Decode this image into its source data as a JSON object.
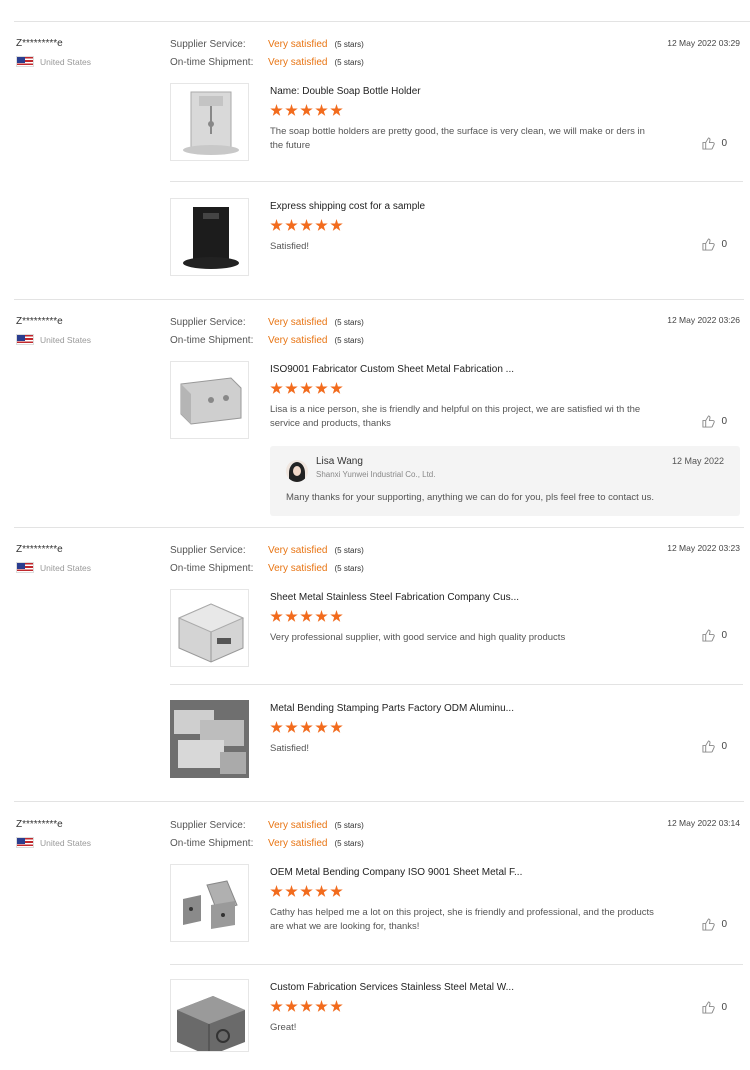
{
  "reviews": [
    {
      "user": "Z*********e",
      "country": "United States",
      "supplier_label": "Supplier Service:",
      "supplier_value": "Very satisfied",
      "supplier_stars": "(5 stars)",
      "shipment_label": "On-time Shipment:",
      "shipment_value": "Very satisfied",
      "shipment_stars": "(5 stars)",
      "date": "12 May 2022 03:29",
      "items": [
        {
          "title": "Name: Double Soap Bottle Holder",
          "rating": 5,
          "text": "The soap bottle holders are pretty good, the surface is very clean, we will make or ders in the future",
          "likes": "0",
          "image": "silver-bracket-image"
        },
        {
          "title": "Express shipping cost for a sample",
          "rating": 5,
          "text": "Satisfied!",
          "likes": "0",
          "image": "black-bracket-image"
        }
      ]
    },
    {
      "user": "Z*********e",
      "country": "United States",
      "supplier_label": "Supplier Service:",
      "supplier_value": "Very satisfied",
      "supplier_stars": "(5 stars)",
      "shipment_label": "On-time Shipment:",
      "shipment_value": "Very satisfied",
      "shipment_stars": "(5 stars)",
      "date": "12 May 2022 03:26",
      "items": [
        {
          "title": "ISO9001 Fabricator Custom Sheet Metal Fabrication ...",
          "rating": 5,
          "text": "Lisa is a nice person, she is friendly and helpful on this project, we are satisfied wi th the service and products, thanks",
          "likes": "0",
          "image": "bent-sheet-image",
          "reply": {
            "name": "Lisa Wang",
            "company": "Shanxi Yunwei Industrial Co., Ltd.",
            "date": "12 May 2022",
            "text": "Many thanks for your supporting, anything we can do for you, pls feel free to contact us."
          }
        }
      ]
    },
    {
      "user": "Z*********e",
      "country": "United States",
      "supplier_label": "Supplier Service:",
      "supplier_value": "Very satisfied",
      "supplier_stars": "(5 stars)",
      "shipment_label": "On-time Shipment:",
      "shipment_value": "Very satisfied",
      "shipment_stars": "(5 stars)",
      "date": "12 May 2022 03:23",
      "items": [
        {
          "title": "Sheet Metal Stainless Steel Fabrication Company Cus...",
          "rating": 5,
          "text": "Very professional supplier, with good service and high quality products",
          "likes": "0",
          "image": "steel-box-image"
        },
        {
          "title": "Metal Bending Stamping Parts Factory ODM Aluminu...",
          "rating": 5,
          "text": "Satisfied!",
          "likes": "0",
          "image": "stacked-parts-image"
        }
      ]
    },
    {
      "user": "Z*********e",
      "country": "United States",
      "supplier_label": "Supplier Service:",
      "supplier_value": "Very satisfied",
      "supplier_stars": "(5 stars)",
      "shipment_label": "On-time Shipment:",
      "shipment_value": "Very satisfied",
      "shipment_stars": "(5 stars)",
      "date": "12 May 2022 03:14",
      "items": [
        {
          "title": "OEM Metal Bending Company ISO 9001 Sheet Metal F...",
          "rating": 5,
          "text": "Cathy has helped me a lot on this project, she is friendly and professional, and the products are what we are looking for, thanks!",
          "likes": "0",
          "image": "brackets-image"
        },
        {
          "title": "Custom Fabrication Services Stainless Steel Metal W...",
          "rating": 5,
          "text": "Great!",
          "likes": "0",
          "image": "metal-enclosure-image"
        }
      ]
    }
  ],
  "colors": {
    "accent": "#e87514",
    "star": "#f26b1d"
  }
}
